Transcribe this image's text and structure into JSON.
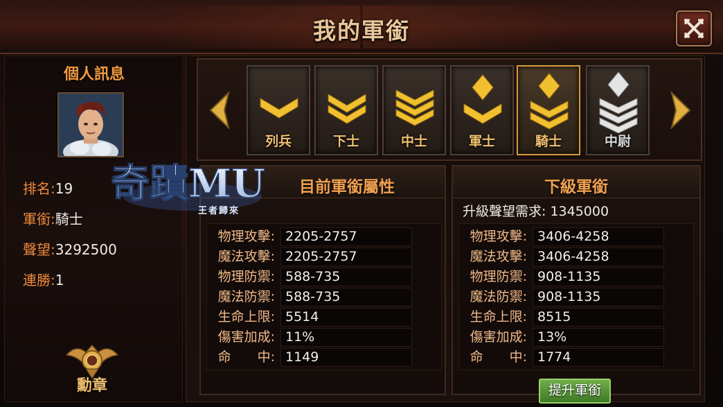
{
  "header": {
    "title": "我的軍銜"
  },
  "left": {
    "title": "個人訊息",
    "stats": [
      {
        "label": "排名:",
        "value": "19"
      },
      {
        "label": "軍銜:",
        "value": "騎士"
      },
      {
        "label": "聲望:",
        "value": "3292500"
      },
      {
        "label": "連勝:",
        "value": "1"
      }
    ],
    "medal_label": "勳章",
    "watermark_title": "奇蹟MU",
    "watermark_sub": "王者歸來"
  },
  "ranks": [
    {
      "name": "列兵",
      "icon": "chevron-1-icon",
      "state": "unlocked"
    },
    {
      "name": "下士",
      "icon": "chevron-2-icon",
      "state": "unlocked"
    },
    {
      "name": "中士",
      "icon": "chevron-3-icon",
      "state": "unlocked"
    },
    {
      "name": "軍士",
      "icon": "diamond-chevron-1-icon",
      "state": "unlocked"
    },
    {
      "name": "騎士",
      "icon": "diamond-chevron-2-icon",
      "state": "selected"
    },
    {
      "name": "中尉",
      "icon": "diamond-chevron-3-icon",
      "state": "locked"
    }
  ],
  "current": {
    "title": "目前軍銜屬性",
    "attributes": [
      {
        "key": "物理攻擊:",
        "value": "2205-2757"
      },
      {
        "key": "魔法攻擊:",
        "value": "2205-2757"
      },
      {
        "key": "物理防禦:",
        "value": "588-735"
      },
      {
        "key": "魔法防禦:",
        "value": "588-735"
      },
      {
        "key": "生命上限:",
        "value": "5514"
      },
      {
        "key": "傷害加成:",
        "value": "11%"
      },
      {
        "key": "命　　中:",
        "value": "1149"
      }
    ]
  },
  "next": {
    "title": "下級軍銜",
    "requirement": "升級聲望需求: 1345000",
    "attributes": [
      {
        "key": "物理攻擊:",
        "value": "3406-4258"
      },
      {
        "key": "魔法攻擊:",
        "value": "3406-4258"
      },
      {
        "key": "物理防禦:",
        "value": "908-1135"
      },
      {
        "key": "魔法防禦:",
        "value": "908-1135"
      },
      {
        "key": "生命上限:",
        "value": "8515"
      },
      {
        "key": "傷害加成:",
        "value": "13%"
      },
      {
        "key": "命　　中:",
        "value": "1774"
      }
    ],
    "button_label": "提升軍銜"
  },
  "colors": {
    "accent_orange": "#f08a3a",
    "gold": "#f0c070",
    "upgrade_green": "#4e8e32"
  }
}
